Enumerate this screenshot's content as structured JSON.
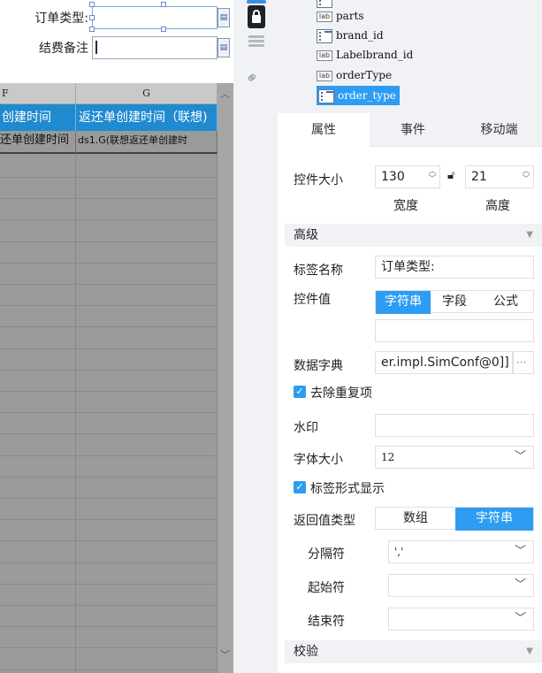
{
  "left_form": {
    "order_type_label": "订单类型:",
    "order_type_value": "",
    "fee_note_label": "结费备注",
    "fee_note_value": ""
  },
  "sheet": {
    "columns": [
      "F",
      "G"
    ],
    "header_cells": [
      "创建时间",
      "返还单创建时间（联想)"
    ],
    "data_cells": [
      "还单创建时间",
      "ds1.G(联想返还单创建时"
    ]
  },
  "tree": {
    "items": [
      {
        "label": "parts",
        "icon": "label-icon"
      },
      {
        "label": "brand_id",
        "icon": "input-icon"
      },
      {
        "label": "Labelbrand_id",
        "icon": "label-icon"
      },
      {
        "label": "orderType",
        "icon": "label-icon"
      },
      {
        "label": "order_type",
        "icon": "input-icon",
        "selected": true
      }
    ]
  },
  "tabs": [
    "属性",
    "事件",
    "移动端"
  ],
  "props": {
    "size_label": "控件大小",
    "width_value": "130",
    "width_caption": "宽度",
    "height_value": "21",
    "height_caption": "高度",
    "advanced_section": "高级",
    "tag_name_label": "标签名称",
    "tag_name_value": "订单类型:",
    "widget_value_label": "控件值",
    "value_modes": [
      "字符串",
      "字段",
      "公式"
    ],
    "widget_value": "",
    "data_dict_label": "数据字典",
    "data_dict_value": "er.impl.SimConf@0]]",
    "data_dict_more": "···",
    "dedupe_label": "去除重复项",
    "dedupe_checked": true,
    "watermark_label": "水印",
    "watermark_value": "",
    "font_size_label": "字体大小",
    "font_size_value": "12",
    "tag_style_label": "标签形式显示",
    "tag_style_checked": true,
    "return_type_label": "返回值类型",
    "return_types": [
      "数组",
      "字符串"
    ],
    "separator_label": "分隔符",
    "separator_value": "','",
    "start_char_label": "起始符",
    "start_char_value": "",
    "end_char_label": "结束符",
    "end_char_value": "",
    "validate_section": "校验"
  },
  "colors": {
    "accent": "#2e9cf2",
    "sheet_header": "#1f8ad0",
    "panel_bg": "#f0f2f5"
  }
}
